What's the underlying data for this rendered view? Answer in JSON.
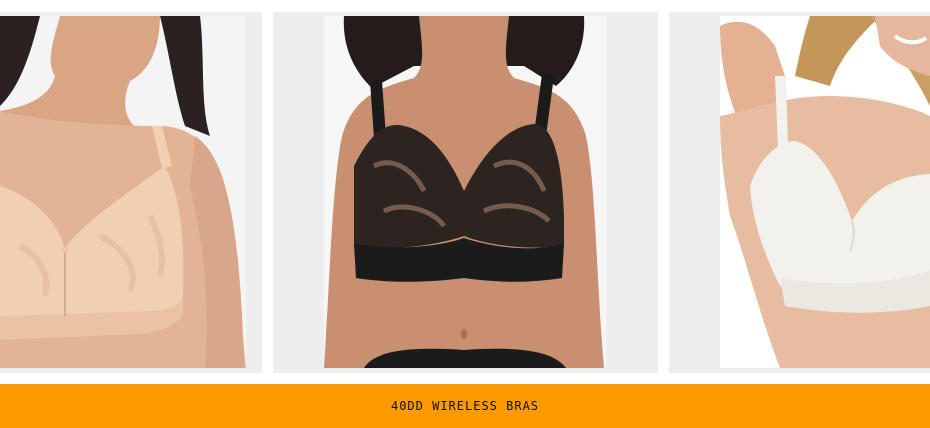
{
  "banner": {
    "label": "40DD WIRELESS BRAS",
    "color": "#ff9900"
  },
  "products": [
    {
      "image": "nude-lace-wireless-bra-photo"
    },
    {
      "image": "black-lace-wireless-bra-photo"
    },
    {
      "image": "ivory-seamless-wireless-bra-photo"
    }
  ],
  "colors": {
    "tile_background": "#eeeeee",
    "skin": "#e2b394",
    "nude_bra": "#f1cfb3",
    "black_bra": "#1b1b1b",
    "ivory_bra": "#f3f1ec"
  }
}
